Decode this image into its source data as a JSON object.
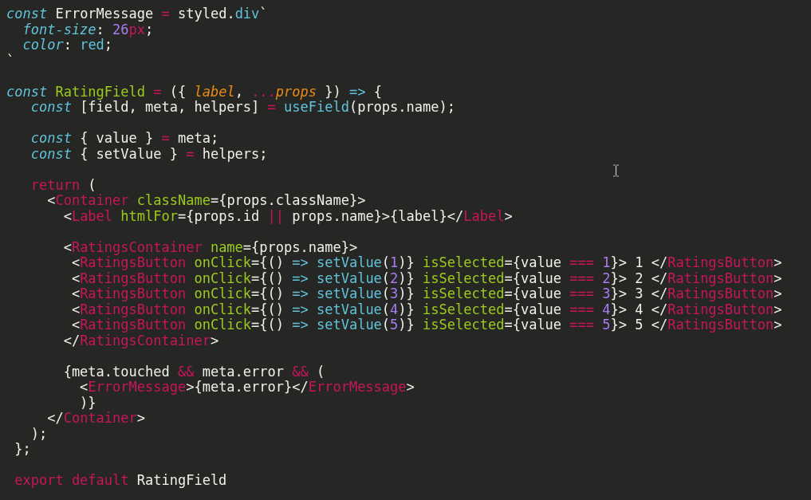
{
  "editor": {
    "lines": [
      {
        "kind": "code",
        "tokens": [
          {
            "kind": "kw",
            "text": "const"
          },
          {
            "kind": "plain",
            "text": " ErrorMessage "
          },
          {
            "kind": "op",
            "text": "="
          },
          {
            "kind": "plain",
            "text": " styled."
          },
          {
            "kind": "fn",
            "text": "div"
          },
          {
            "kind": "plain",
            "text": "`"
          }
        ]
      },
      {
        "kind": "code",
        "tokens": [
          {
            "kind": "prop",
            "text": "  font-size"
          },
          {
            "kind": "plain",
            "text": ": "
          },
          {
            "kind": "num",
            "text": "26"
          },
          {
            "kind": "op",
            "text": "px"
          },
          {
            "kind": "plain",
            "text": ";"
          }
        ]
      },
      {
        "kind": "code",
        "tokens": [
          {
            "kind": "prop",
            "text": "  color"
          },
          {
            "kind": "plain",
            "text": ": "
          },
          {
            "kind": "fn",
            "text": "red"
          },
          {
            "kind": "plain",
            "text": ";"
          }
        ]
      },
      {
        "kind": "code",
        "tokens": [
          {
            "kind": "plain",
            "text": "`"
          }
        ]
      },
      {
        "kind": "blank"
      },
      {
        "kind": "code",
        "tokens": [
          {
            "kind": "kw",
            "text": "const"
          },
          {
            "kind": "entity",
            "text": " RatingField"
          },
          {
            "kind": "op",
            "text": " ="
          },
          {
            "kind": "plain",
            "text": " ({ "
          },
          {
            "kind": "param",
            "text": "label"
          },
          {
            "kind": "plain",
            "text": ", "
          },
          {
            "kind": "op",
            "text": "..."
          },
          {
            "kind": "param",
            "text": "props"
          },
          {
            "kind": "plain",
            "text": " }) "
          },
          {
            "kind": "fn",
            "text": "=>"
          },
          {
            "kind": "plain",
            "text": " {"
          }
        ]
      },
      {
        "kind": "code",
        "tokens": [
          {
            "kind": "kw",
            "text": "   const"
          },
          {
            "kind": "plain",
            "text": " [field, meta, helpers] "
          },
          {
            "kind": "op",
            "text": "="
          },
          {
            "kind": "fn",
            "text": " useField"
          },
          {
            "kind": "plain",
            "text": "(props.name);"
          }
        ]
      },
      {
        "kind": "blank"
      },
      {
        "kind": "code",
        "tokens": [
          {
            "kind": "kw",
            "text": "   const"
          },
          {
            "kind": "plain",
            "text": " { value } "
          },
          {
            "kind": "op",
            "text": "="
          },
          {
            "kind": "plain",
            "text": " meta;"
          }
        ]
      },
      {
        "kind": "code",
        "tokens": [
          {
            "kind": "kw",
            "text": "   const"
          },
          {
            "kind": "plain",
            "text": " { setValue } "
          },
          {
            "kind": "op",
            "text": "="
          },
          {
            "kind": "plain",
            "text": " helpers;"
          }
        ]
      },
      {
        "kind": "blank"
      },
      {
        "kind": "code",
        "tokens": [
          {
            "kind": "op",
            "text": "   return"
          },
          {
            "kind": "plain",
            "text": " ("
          }
        ]
      },
      {
        "kind": "code",
        "tokens": [
          {
            "kind": "plain",
            "text": "     <"
          },
          {
            "kind": "tag",
            "text": "Container"
          },
          {
            "kind": "attr",
            "text": " className"
          },
          {
            "kind": "plain",
            "text": "={props.className}>"
          }
        ]
      },
      {
        "kind": "code",
        "tokens": [
          {
            "kind": "plain",
            "text": "       <"
          },
          {
            "kind": "tag",
            "text": "Label"
          },
          {
            "kind": "attr",
            "text": " htmlFor"
          },
          {
            "kind": "plain",
            "text": "={props.id "
          },
          {
            "kind": "op",
            "text": "||"
          },
          {
            "kind": "plain",
            "text": " props.name}>{label}</"
          },
          {
            "kind": "tag",
            "text": "Label"
          },
          {
            "kind": "plain",
            "text": ">"
          }
        ]
      },
      {
        "kind": "blank"
      },
      {
        "kind": "code",
        "tokens": [
          {
            "kind": "plain",
            "text": "       <"
          },
          {
            "kind": "tag",
            "text": "RatingsContainer"
          },
          {
            "kind": "attr",
            "text": " name"
          },
          {
            "kind": "plain",
            "text": "={props.name}>"
          }
        ]
      },
      {
        "kind": "code",
        "tokens": [
          {
            "kind": "plain",
            "text": "        <"
          },
          {
            "kind": "tag",
            "text": "RatingsButton"
          },
          {
            "kind": "attr",
            "text": " onClick"
          },
          {
            "kind": "plain",
            "text": "={() "
          },
          {
            "kind": "fn",
            "text": "=> setValue"
          },
          {
            "kind": "plain",
            "text": "("
          },
          {
            "kind": "num",
            "text": "1"
          },
          {
            "kind": "plain",
            "text": ")} "
          },
          {
            "kind": "attr",
            "text": "isSelected"
          },
          {
            "kind": "plain",
            "text": "={value "
          },
          {
            "kind": "op",
            "text": "==="
          },
          {
            "kind": "num",
            "text": " 1"
          },
          {
            "kind": "plain",
            "text": "}> 1 </"
          },
          {
            "kind": "tag",
            "text": "RatingsButton"
          },
          {
            "kind": "plain",
            "text": ">"
          }
        ]
      },
      {
        "kind": "code",
        "tokens": [
          {
            "kind": "plain",
            "text": "        <"
          },
          {
            "kind": "tag",
            "text": "RatingsButton"
          },
          {
            "kind": "attr",
            "text": " onClick"
          },
          {
            "kind": "plain",
            "text": "={() "
          },
          {
            "kind": "fn",
            "text": "=> setValue"
          },
          {
            "kind": "plain",
            "text": "("
          },
          {
            "kind": "num",
            "text": "2"
          },
          {
            "kind": "plain",
            "text": ")} "
          },
          {
            "kind": "attr",
            "text": "isSelected"
          },
          {
            "kind": "plain",
            "text": "={value "
          },
          {
            "kind": "op",
            "text": "==="
          },
          {
            "kind": "num",
            "text": " 2"
          },
          {
            "kind": "plain",
            "text": "}> 2 </"
          },
          {
            "kind": "tag",
            "text": "RatingsButton"
          },
          {
            "kind": "plain",
            "text": ">"
          }
        ]
      },
      {
        "kind": "code",
        "tokens": [
          {
            "kind": "plain",
            "text": "        <"
          },
          {
            "kind": "tag",
            "text": "RatingsButton"
          },
          {
            "kind": "attr",
            "text": " onClick"
          },
          {
            "kind": "plain",
            "text": "={() "
          },
          {
            "kind": "fn",
            "text": "=> setValue"
          },
          {
            "kind": "plain",
            "text": "("
          },
          {
            "kind": "num",
            "text": "3"
          },
          {
            "kind": "plain",
            "text": ")} "
          },
          {
            "kind": "attr",
            "text": "isSelected"
          },
          {
            "kind": "plain",
            "text": "={value "
          },
          {
            "kind": "op",
            "text": "==="
          },
          {
            "kind": "num",
            "text": " 3"
          },
          {
            "kind": "plain",
            "text": "}> 3 </"
          },
          {
            "kind": "tag",
            "text": "RatingsButton"
          },
          {
            "kind": "plain",
            "text": ">"
          }
        ]
      },
      {
        "kind": "code",
        "tokens": [
          {
            "kind": "plain",
            "text": "        <"
          },
          {
            "kind": "tag",
            "text": "RatingsButton"
          },
          {
            "kind": "attr",
            "text": " onClick"
          },
          {
            "kind": "plain",
            "text": "={() "
          },
          {
            "kind": "fn",
            "text": "=> setValue"
          },
          {
            "kind": "plain",
            "text": "("
          },
          {
            "kind": "num",
            "text": "4"
          },
          {
            "kind": "plain",
            "text": ")} "
          },
          {
            "kind": "attr",
            "text": "isSelected"
          },
          {
            "kind": "plain",
            "text": "={value "
          },
          {
            "kind": "op",
            "text": "==="
          },
          {
            "kind": "num",
            "text": " 4"
          },
          {
            "kind": "plain",
            "text": "}> 4 </"
          },
          {
            "kind": "tag",
            "text": "RatingsButton"
          },
          {
            "kind": "plain",
            "text": ">"
          }
        ]
      },
      {
        "kind": "code",
        "tokens": [
          {
            "kind": "plain",
            "text": "        <"
          },
          {
            "kind": "tag",
            "text": "RatingsButton"
          },
          {
            "kind": "attr",
            "text": " onClick"
          },
          {
            "kind": "plain",
            "text": "={() "
          },
          {
            "kind": "fn",
            "text": "=> setValue"
          },
          {
            "kind": "plain",
            "text": "("
          },
          {
            "kind": "num",
            "text": "5"
          },
          {
            "kind": "plain",
            "text": ")} "
          },
          {
            "kind": "attr",
            "text": "isSelected"
          },
          {
            "kind": "plain",
            "text": "={value "
          },
          {
            "kind": "op",
            "text": "==="
          },
          {
            "kind": "num",
            "text": " 5"
          },
          {
            "kind": "plain",
            "text": "}> 5 </"
          },
          {
            "kind": "tag",
            "text": "RatingsButton"
          },
          {
            "kind": "plain",
            "text": ">"
          }
        ]
      },
      {
        "kind": "code",
        "tokens": [
          {
            "kind": "plain",
            "text": "       </"
          },
          {
            "kind": "tag",
            "text": "RatingsContainer"
          },
          {
            "kind": "plain",
            "text": ">"
          }
        ]
      },
      {
        "kind": "blank"
      },
      {
        "kind": "code",
        "tokens": [
          {
            "kind": "plain",
            "text": "       {meta.touched "
          },
          {
            "kind": "op",
            "text": "&&"
          },
          {
            "kind": "plain",
            "text": " meta.error "
          },
          {
            "kind": "op",
            "text": "&&"
          },
          {
            "kind": "plain",
            "text": " ("
          }
        ]
      },
      {
        "kind": "code",
        "tokens": [
          {
            "kind": "plain",
            "text": "         <"
          },
          {
            "kind": "tag",
            "text": "ErrorMessage"
          },
          {
            "kind": "plain",
            "text": ">{meta.error}</"
          },
          {
            "kind": "tag",
            "text": "ErrorMessage"
          },
          {
            "kind": "plain",
            "text": ">"
          }
        ]
      },
      {
        "kind": "code",
        "tokens": [
          {
            "kind": "plain",
            "text": "         )}"
          }
        ]
      },
      {
        "kind": "code",
        "tokens": [
          {
            "kind": "plain",
            "text": "     </"
          },
          {
            "kind": "tag",
            "text": "Container"
          },
          {
            "kind": "plain",
            "text": ">"
          }
        ]
      },
      {
        "kind": "code",
        "tokens": [
          {
            "kind": "plain",
            "text": "   );"
          }
        ]
      },
      {
        "kind": "code",
        "tokens": [
          {
            "kind": "plain",
            "text": " };"
          }
        ]
      },
      {
        "kind": "blank"
      },
      {
        "kind": "code",
        "tokens": [
          {
            "kind": "op",
            "text": " export default"
          },
          {
            "kind": "plain",
            "text": " RatingField"
          }
        ]
      }
    ]
  }
}
